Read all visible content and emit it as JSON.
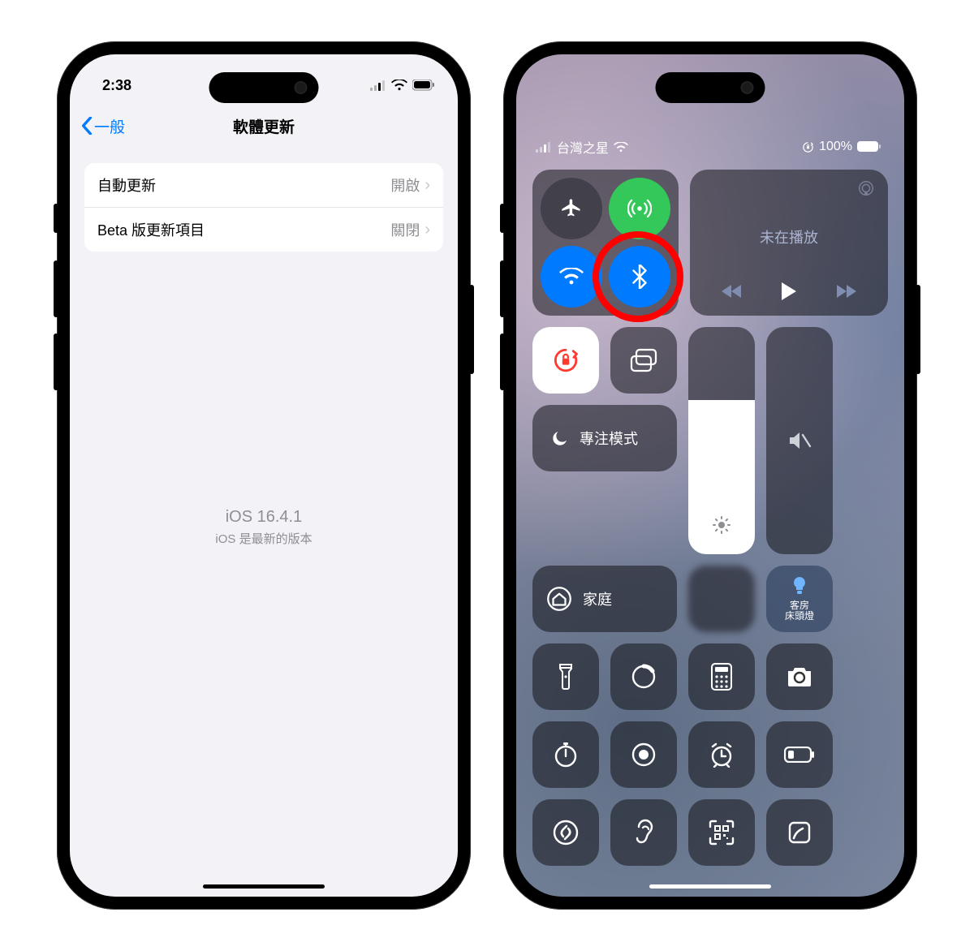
{
  "left": {
    "status": {
      "time": "2:38"
    },
    "nav": {
      "back": "一般",
      "title": "軟體更新"
    },
    "rows": [
      {
        "label": "自動更新",
        "value": "開啟"
      },
      {
        "label": "Beta 版更新項目",
        "value": "關閉"
      }
    ],
    "version": "iOS 16.4.1",
    "version_sub": "iOS 是最新的版本"
  },
  "right": {
    "status": {
      "carrier": "台灣之星",
      "battery": "100%"
    },
    "media": {
      "title": "未在播放"
    },
    "focus": {
      "label": "專注模式"
    },
    "home": {
      "label": "家庭"
    },
    "lamp": {
      "line1": "客房",
      "line2": "床頭燈"
    }
  }
}
